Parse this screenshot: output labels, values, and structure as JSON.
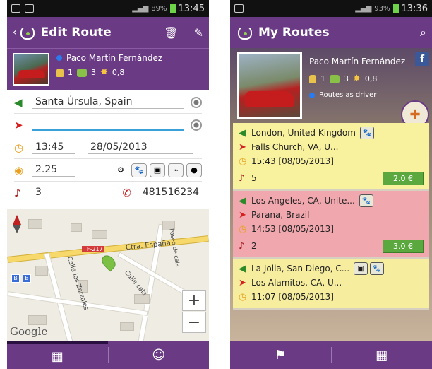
{
  "left": {
    "status": {
      "battery": "89%",
      "time": "13:45"
    },
    "title": "Edit Route",
    "profile": {
      "name": "Paco Martín Fernández",
      "stat_drivers": "1",
      "stat_groups": "3",
      "rating": "0,8"
    },
    "form": {
      "origin": "Santa Úrsula, Spain",
      "destination": "",
      "time": "13:45",
      "date": "28/05/2013",
      "price": "2.25",
      "seats": "3",
      "phone": "481516234"
    },
    "map": {
      "road_label": "Ctra. España",
      "street1": "Calle los Zarzales",
      "street2": "Calle cala",
      "street3": "Paseo de cala",
      "route_shield": "TF-217",
      "zoom_in": "+",
      "zoom_out": "−",
      "attribution": "Google"
    }
  },
  "right": {
    "status": {
      "battery": "93%",
      "time": "13:36"
    },
    "title": "My Routes",
    "profile": {
      "name": "Paco Martín Fernández",
      "stat_drivers": "1",
      "stat_groups": "3",
      "rating": "0,8",
      "role": "Routes as driver"
    },
    "routes": [
      {
        "from": "London, United Kingdom",
        "to": "Falls Church, VA, U...",
        "time": "15:43 [08/05/2013]",
        "seats": "5",
        "price": "2.0 €"
      },
      {
        "from": "Los Angeles, CA, Unite...",
        "to": "Parana, Brazil",
        "time": "14:53 [08/05/2013]",
        "seats": "2",
        "price": "3.0 €"
      },
      {
        "from": "La Jolla, San Diego, C...",
        "to": "Los Alamitos, CA, U...",
        "time": "11:07 [08/05/2013]"
      }
    ]
  },
  "colors": {
    "primary": "#6b3a85",
    "route_yellow": "#f8f19e",
    "route_pink": "#f0a7ae",
    "price_green": "#5aa83e"
  }
}
